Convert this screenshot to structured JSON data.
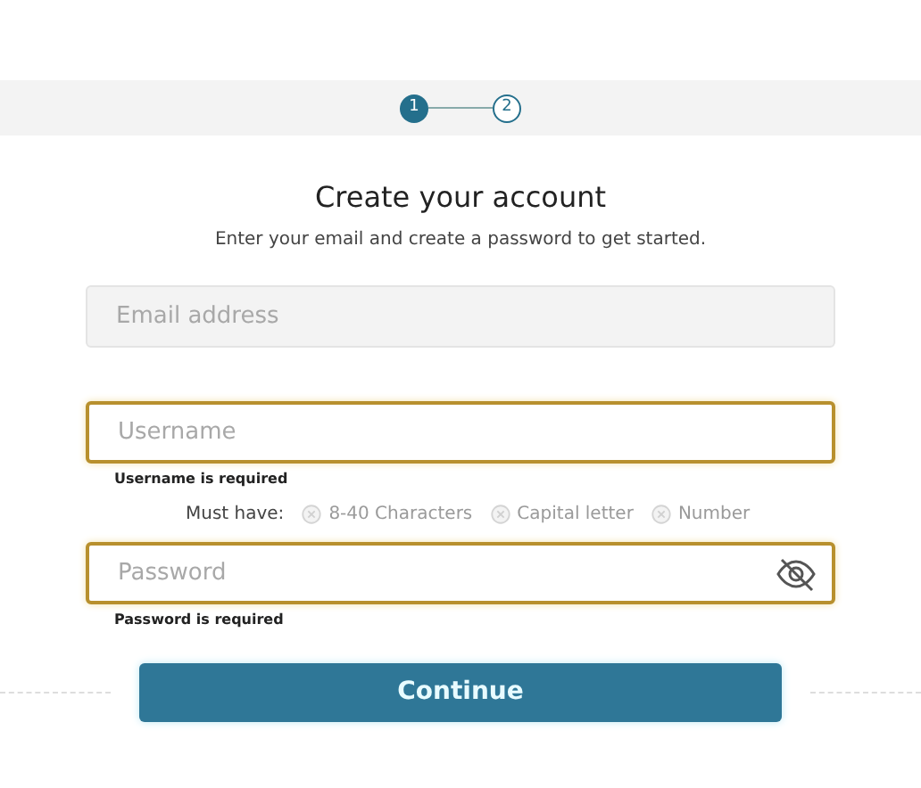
{
  "steps": [
    {
      "label": "1",
      "selected": true
    },
    {
      "label": "2",
      "selected": false
    }
  ],
  "title": "Create your account",
  "subtitle": "Enter your email and create a password to get started.",
  "fields": [
    {
      "kind": "email",
      "placeholder": "Email address",
      "invalid": false
    },
    {
      "kind": "text",
      "placeholder": "Username",
      "invalid": true,
      "error": "Username is required",
      "requirements_label": "Must have:",
      "requirements": [
        {
          "label": "8-40 Characters",
          "met": false
        },
        {
          "label": "Capital letter",
          "met": false
        },
        {
          "label": "Number",
          "met": false
        }
      ]
    },
    {
      "kind": "password",
      "placeholder": "Password",
      "invalid": true,
      "error": "Password is required"
    }
  ],
  "button": "Continue"
}
